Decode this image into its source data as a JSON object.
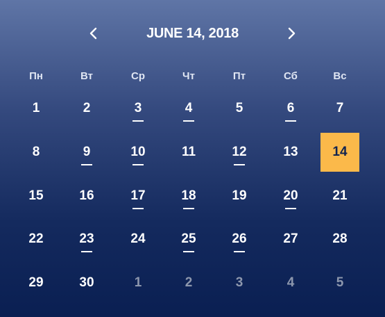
{
  "header": {
    "title": "JUNE 14, 2018",
    "prev_icon": "chevron-left-icon",
    "next_icon": "chevron-right-icon"
  },
  "weekdays": [
    "Пн",
    "Вт",
    "Ср",
    "Чт",
    "Пт",
    "Сб",
    "Вс"
  ],
  "colors": {
    "selected_bg": "#fbb94a",
    "muted_text": "#8d97ad",
    "event_marker": "#ffffff"
  },
  "weeks": [
    [
      {
        "day": "1",
        "event": false,
        "muted": false,
        "selected": false
      },
      {
        "day": "2",
        "event": false,
        "muted": false,
        "selected": false
      },
      {
        "day": "3",
        "event": true,
        "muted": false,
        "selected": false
      },
      {
        "day": "4",
        "event": true,
        "muted": false,
        "selected": false
      },
      {
        "day": "5",
        "event": false,
        "muted": false,
        "selected": false
      },
      {
        "day": "6",
        "event": true,
        "muted": false,
        "selected": false
      },
      {
        "day": "7",
        "event": false,
        "muted": false,
        "selected": false
      }
    ],
    [
      {
        "day": "8",
        "event": false,
        "muted": false,
        "selected": false
      },
      {
        "day": "9",
        "event": true,
        "muted": false,
        "selected": false
      },
      {
        "day": "10",
        "event": true,
        "muted": false,
        "selected": false
      },
      {
        "day": "11",
        "event": false,
        "muted": false,
        "selected": false
      },
      {
        "day": "12",
        "event": true,
        "muted": false,
        "selected": false
      },
      {
        "day": "13",
        "event": false,
        "muted": false,
        "selected": false
      },
      {
        "day": "14",
        "event": false,
        "muted": false,
        "selected": true
      }
    ],
    [
      {
        "day": "15",
        "event": false,
        "muted": false,
        "selected": false
      },
      {
        "day": "16",
        "event": false,
        "muted": false,
        "selected": false
      },
      {
        "day": "17",
        "event": true,
        "muted": false,
        "selected": false
      },
      {
        "day": "18",
        "event": true,
        "muted": false,
        "selected": false
      },
      {
        "day": "19",
        "event": false,
        "muted": false,
        "selected": false
      },
      {
        "day": "20",
        "event": true,
        "muted": false,
        "selected": false
      },
      {
        "day": "21",
        "event": false,
        "muted": false,
        "selected": false
      }
    ],
    [
      {
        "day": "22",
        "event": false,
        "muted": false,
        "selected": false
      },
      {
        "day": "23",
        "event": true,
        "muted": false,
        "selected": false
      },
      {
        "day": "24",
        "event": false,
        "muted": false,
        "selected": false
      },
      {
        "day": "25",
        "event": true,
        "muted": false,
        "selected": false
      },
      {
        "day": "26",
        "event": true,
        "muted": false,
        "selected": false
      },
      {
        "day": "27",
        "event": false,
        "muted": false,
        "selected": false
      },
      {
        "day": "28",
        "event": false,
        "muted": false,
        "selected": false
      }
    ],
    [
      {
        "day": "29",
        "event": false,
        "muted": false,
        "selected": false
      },
      {
        "day": "30",
        "event": false,
        "muted": false,
        "selected": false
      },
      {
        "day": "1",
        "event": false,
        "muted": true,
        "selected": false
      },
      {
        "day": "2",
        "event": false,
        "muted": true,
        "selected": false
      },
      {
        "day": "3",
        "event": false,
        "muted": true,
        "selected": false
      },
      {
        "day": "4",
        "event": false,
        "muted": true,
        "selected": false
      },
      {
        "day": "5",
        "event": false,
        "muted": true,
        "selected": false
      }
    ]
  ]
}
